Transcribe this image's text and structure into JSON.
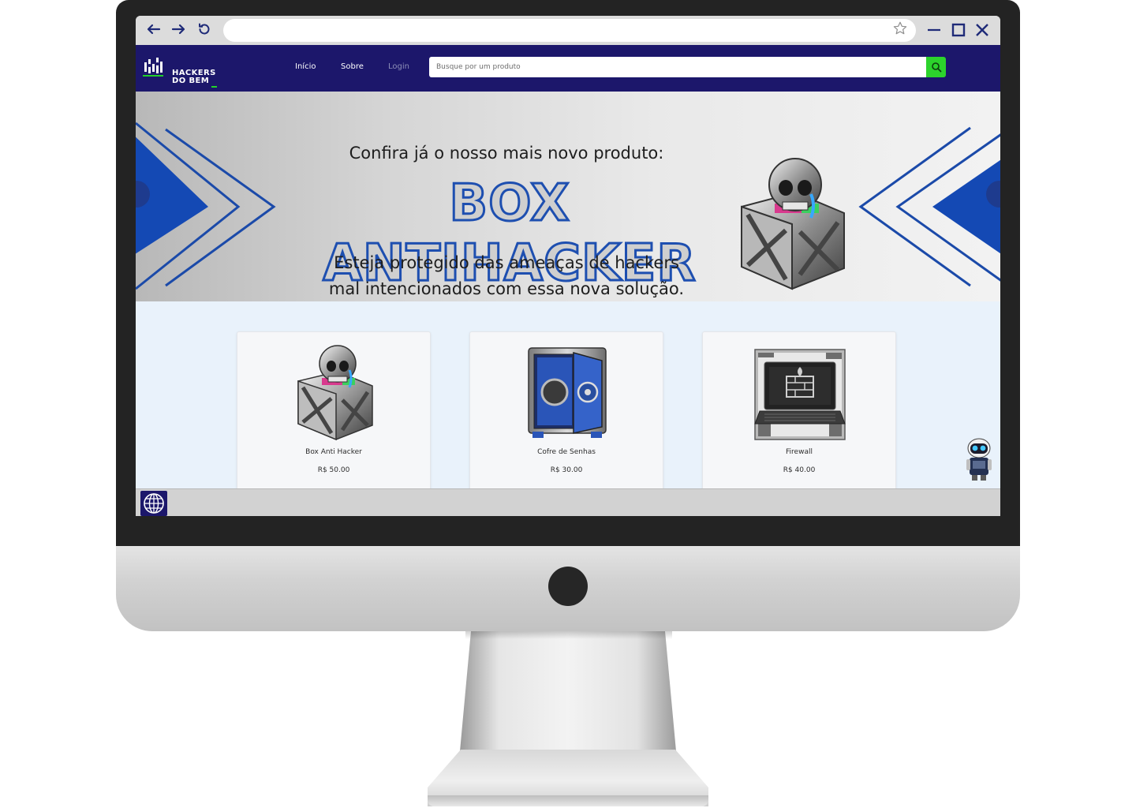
{
  "browser": {
    "address_value": "",
    "icons": {
      "back": "arrow-left-icon",
      "forward": "arrow-right-icon",
      "reload": "reload-icon",
      "bookmark": "star-icon",
      "minimize": "minimize-icon",
      "maximize": "maximize-icon",
      "close": "close-icon"
    }
  },
  "header": {
    "logo_line1": "HACKERS",
    "logo_line2": "DO BEM",
    "nav": [
      {
        "label": "Início"
      },
      {
        "label": "Sobre"
      },
      {
        "label": "Login"
      }
    ],
    "search_placeholder": "Busque por um produto",
    "search_icon": "search-icon"
  },
  "banner": {
    "line1": "Confira já o nosso mais novo produto:",
    "title": "BOX ANTIHACKER",
    "subtitle_line1": "Esteja protegido das ameaças de hackers",
    "subtitle_line2": "mal intencionados com essa nova solução."
  },
  "products": [
    {
      "name": "Box Anti Hacker",
      "price": "R$ 50.00",
      "icon": "skull-box-icon"
    },
    {
      "name": "Cofre de Senhas",
      "price": "R$ 30.00",
      "icon": "safe-icon"
    },
    {
      "name": "Firewall",
      "price": "R$ 40.00",
      "icon": "laptop-firewall-icon"
    }
  ],
  "taskbar": {
    "icon": "globe-icon"
  },
  "colors": {
    "header_bg": "#1c176b",
    "search_button": "#2cd32c",
    "accent_blue": "#1e4fb0",
    "content_bg": "#e9f2fb"
  }
}
